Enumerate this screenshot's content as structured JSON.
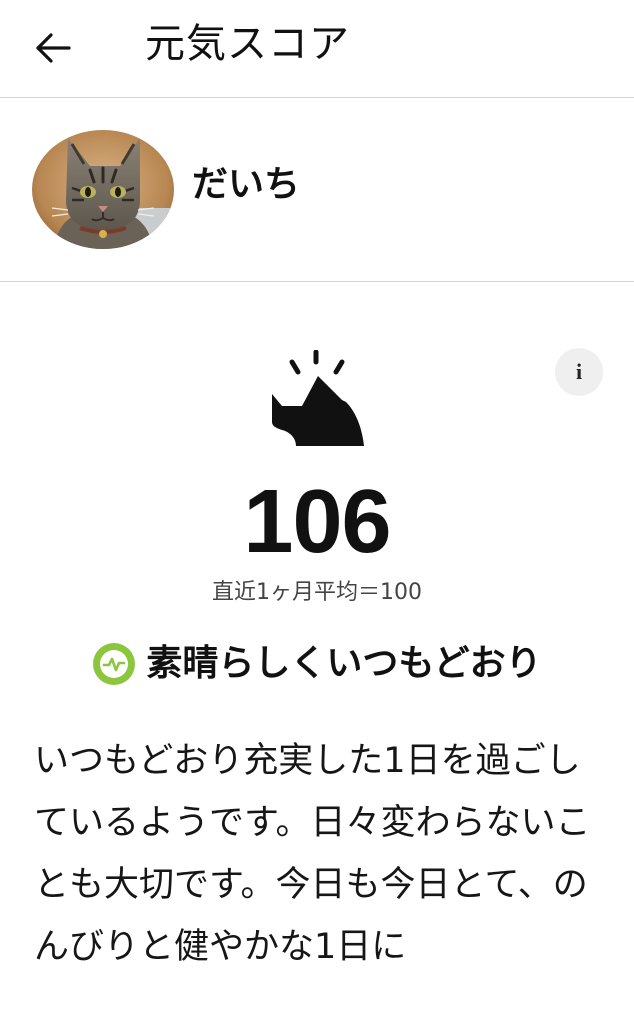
{
  "header": {
    "back_icon": "arrow-left-icon",
    "title": "元気スコア"
  },
  "profile": {
    "avatar": "cat-photo",
    "name": "だいち"
  },
  "score": {
    "icon": "cat-sunrise-icon",
    "info_icon": "info-icon",
    "info_label": "i",
    "value": "106",
    "average_text": "直近1ヶ月平均＝100"
  },
  "status": {
    "icon": "pulse-icon",
    "icon_color": "#8cc63f",
    "label": "素晴らしくいつもどおり"
  },
  "message": "いつもどおり充実した1日を過ごしているようです。日々変わらないことも大切です。今日も今日とて、のんびりと健やかな1日に"
}
